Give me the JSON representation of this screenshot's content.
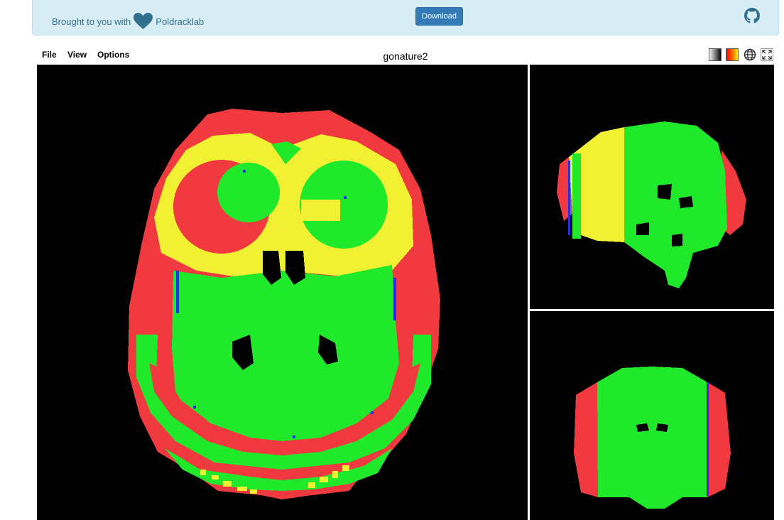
{
  "banner": {
    "prefix": "Brought to you with",
    "lab_link": "Poldracklab",
    "download_label": "Download",
    "heart_icon": "heart-icon",
    "github_icon": "github-icon",
    "colors": {
      "banner_bg": "#d9edf7",
      "text": "#31708f",
      "button": "#337ab7"
    }
  },
  "menubar": {
    "items": [
      "File",
      "View",
      "Options"
    ],
    "title": "gonature2",
    "tools": [
      {
        "icon": "grayscale-colormap-icon"
      },
      {
        "icon": "hot-colormap-icon"
      },
      {
        "icon": "globe-icon"
      },
      {
        "icon": "fullscreen-icon"
      }
    ]
  },
  "viewer": {
    "views": [
      "axial",
      "sagittal",
      "coronal"
    ],
    "overlay_colors": {
      "red": "#f03a3f",
      "yellow": "#f2f032",
      "green": "#20e82a",
      "blue": "#2030f0",
      "background": "#000000"
    }
  }
}
